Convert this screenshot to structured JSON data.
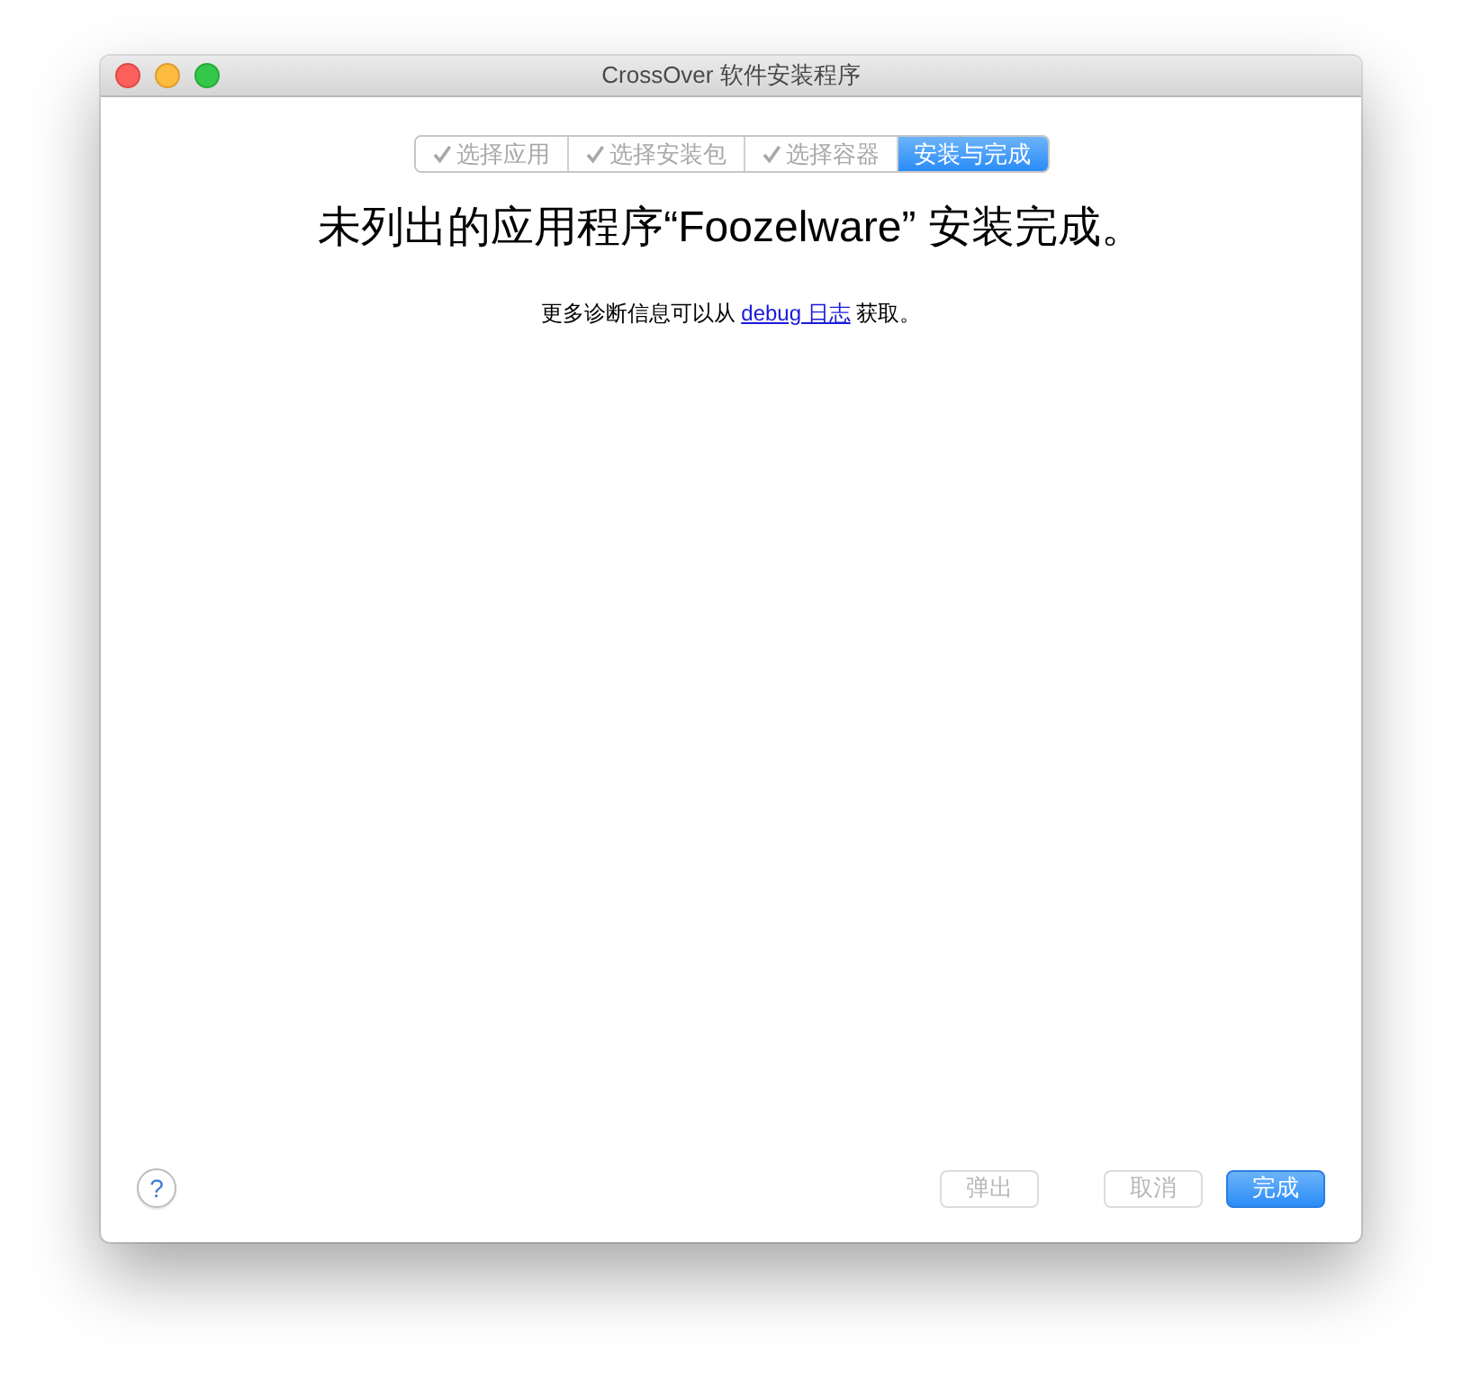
{
  "window": {
    "title": "CrossOver 软件安装程序"
  },
  "steps": [
    {
      "label": "选择应用",
      "done": true,
      "selected": false
    },
    {
      "label": "选择安装包",
      "done": true,
      "selected": false
    },
    {
      "label": "选择容器",
      "done": true,
      "selected": false
    },
    {
      "label": "安装与完成",
      "done": false,
      "selected": true
    }
  ],
  "heading": "未列出的应用程序“Foozelware” 安装完成。",
  "message": {
    "before": "更多诊断信息可以从 ",
    "link": "debug 日志",
    "after": " 获取。"
  },
  "help_button": "?",
  "buttons": [
    {
      "label": "弹出",
      "disabled": true,
      "default": false
    },
    {
      "label": "取消",
      "disabled": true,
      "default": false
    },
    {
      "label": "完成",
      "disabled": false,
      "default": true
    }
  ]
}
